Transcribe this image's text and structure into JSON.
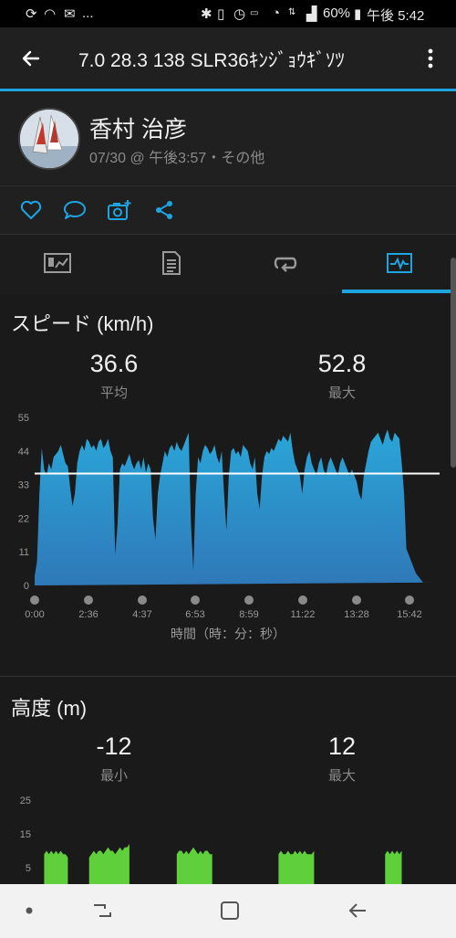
{
  "status_bar": {
    "battery": "60%",
    "time": "午後 5:42",
    "notif_more": "..."
  },
  "app_bar": {
    "title": "7.0  28.3  138  SLR36ｷﾝｼﾞｮｳｷﾞｿﾂ"
  },
  "profile": {
    "name": "香村 治彦",
    "meta": "07/30 @ 午後3:57・その他"
  },
  "tabs": [
    {
      "name": "summary",
      "active": false
    },
    {
      "name": "details",
      "active": false
    },
    {
      "name": "laps",
      "active": false
    },
    {
      "name": "charts",
      "active": true
    }
  ],
  "speed_section": {
    "title": "スピード (km/h)",
    "avg_value": "36.6",
    "avg_label": "平均",
    "max_value": "52.8",
    "max_label": "最大",
    "x_axis_label": "時間（時：分：秒）"
  },
  "altitude_section": {
    "title": "高度 (m)",
    "min_value": "-12",
    "min_label": "最小",
    "max_value": "12",
    "max_label": "最大"
  },
  "colors": {
    "accent": "#1ea5e0",
    "speed_fill_top": "#2aa6d8",
    "speed_fill_bottom": "#2f78b8",
    "altitude_fill": "#5fcf3c",
    "avg_line": "#ffffff"
  },
  "chart_data": [
    {
      "type": "area",
      "title": "スピード (km/h)",
      "xlabel": "時間（時：分：秒）",
      "ylabel": "",
      "x_ticks": [
        "0:00",
        "2:36",
        "4:37",
        "6:53",
        "8:59",
        "11:22",
        "13:28",
        "15:42"
      ],
      "y_ticks": [
        "0",
        "11",
        "22",
        "33",
        "44",
        "55"
      ],
      "ylim": [
        0,
        55
      ],
      "average_line": 36.6,
      "x": [
        0,
        0.1,
        0.2,
        0.3,
        0.4,
        0.5,
        0.6,
        0.7,
        0.8,
        0.9,
        1.0,
        1.1,
        1.2,
        1.3,
        1.4,
        1.5,
        1.6,
        1.7,
        1.8,
        1.9,
        2.0,
        2.1,
        2.2,
        2.3,
        2.4,
        2.5,
        2.6,
        2.7,
        2.8,
        2.9,
        3.0,
        3.1,
        3.2,
        3.3,
        3.4,
        3.5,
        3.6,
        3.7,
        3.8,
        3.9,
        4.0,
        4.1,
        4.2,
        4.3,
        4.4,
        4.5,
        4.6,
        4.7,
        4.8,
        4.9,
        5.0,
        5.1,
        5.2,
        5.3,
        5.4,
        5.5,
        5.6,
        5.7,
        5.8,
        5.9,
        6.0,
        6.1,
        6.2,
        6.3,
        6.4,
        6.5,
        6.6,
        6.7,
        6.8,
        6.9,
        7.0,
        7.1,
        7.2,
        7.3,
        7.4,
        7.5,
        7.6,
        7.7,
        7.8,
        7.9,
        8.0,
        8.1,
        8.2,
        8.3,
        8.4,
        8.5,
        8.6,
        8.7,
        8.8,
        8.9,
        9.0,
        9.1,
        9.2,
        9.3,
        9.4,
        9.5,
        9.6,
        9.7,
        9.8,
        9.9,
        10.0,
        10.1,
        10.2,
        10.3,
        10.4,
        10.5,
        10.6,
        10.7,
        10.8,
        10.9,
        11.0,
        11.1,
        11.2,
        11.3,
        11.4,
        11.5,
        11.6,
        11.7,
        11.8,
        11.9,
        12.0,
        12.1,
        12.2,
        12.3,
        12.4,
        12.5,
        12.6,
        12.7,
        12.8,
        12.9,
        13.0,
        13.1,
        13.2,
        13.3,
        13.4,
        13.5,
        13.6,
        13.7,
        13.8,
        13.9,
        14.0,
        14.1,
        14.2,
        14.3,
        14.4,
        14.5,
        14.6,
        14.7,
        14.8,
        14.9,
        15.0,
        15.1,
        15.2,
        15.3,
        15.4,
        15.5,
        15.6,
        15.7,
        15.8,
        15.9,
        16.0,
        16.1,
        16.2,
        16.3,
        16.4,
        16.5,
        16.6,
        16.7,
        16.8,
        16.9,
        17.0,
        17.1
      ],
      "series": [
        {
          "values": [
            3,
            8,
            30,
            45,
            38,
            36,
            40,
            38,
            42,
            43,
            44,
            46,
            43,
            40,
            39,
            32,
            26,
            30,
            40,
            44,
            46,
            44,
            48,
            47,
            45,
            46,
            44,
            47,
            48,
            45,
            46,
            48,
            44,
            42,
            10,
            20,
            38,
            40,
            39,
            41,
            43,
            40,
            38,
            40,
            41,
            38,
            42,
            37,
            40,
            38,
            22,
            15,
            30,
            36,
            40,
            44,
            42,
            45,
            46,
            44,
            47,
            45,
            44,
            46,
            48,
            50,
            20,
            5,
            30,
            42,
            40,
            44,
            46,
            45,
            43,
            44,
            46,
            42,
            40,
            44,
            30,
            18,
            36,
            44,
            45,
            43,
            44,
            42,
            46,
            45,
            44,
            40,
            38,
            42,
            30,
            25,
            36,
            42,
            44,
            43,
            45,
            44,
            46,
            48,
            47,
            49,
            48,
            47,
            50,
            44,
            40,
            38,
            36,
            30,
            38,
            42,
            44,
            40,
            38,
            36,
            40,
            42,
            38,
            36,
            40,
            42,
            40,
            38,
            36,
            40,
            42,
            40,
            38,
            36,
            38,
            36,
            34,
            30,
            28,
            36,
            40,
            44,
            47,
            48,
            49,
            50,
            48,
            46,
            49,
            51,
            48,
            47,
            50,
            49,
            48,
            40,
            30,
            12,
            10,
            8,
            6,
            4,
            3,
            2,
            1,
            1,
            1,
            1,
            1,
            1,
            1
          ]
        }
      ]
    },
    {
      "type": "area",
      "title": "高度 (m)",
      "y_ticks": [
        "5",
        "15",
        "25"
      ],
      "x": [
        0,
        0.1,
        0.2,
        0.3,
        0.4,
        0.5,
        0.6,
        0.7,
        0.8,
        0.9,
        1.0,
        1.1,
        1.2,
        1.3,
        1.4,
        1.5,
        1.6,
        1.7,
        1.8,
        1.9,
        2.0,
        2.1,
        2.2,
        2.3,
        2.4,
        2.5,
        2.6,
        2.7,
        2.8,
        2.9,
        3.0,
        3.1,
        3.2,
        3.3,
        3.4,
        3.5,
        3.6,
        3.7,
        3.8,
        3.9,
        4.0,
        4.1,
        4.2,
        4.3,
        4.4,
        4.5,
        4.6,
        4.7,
        4.8,
        4.9,
        5.0,
        5.1,
        5.2,
        5.3,
        5.4,
        5.5,
        5.6,
        5.7,
        5.8,
        5.9,
        6.0,
        6.1,
        6.2,
        6.3,
        6.4,
        6.5,
        6.6,
        6.7,
        6.8,
        6.9,
        7.0,
        7.1,
        7.2,
        7.3,
        7.4,
        7.5,
        7.6,
        7.7,
        7.8,
        7.9,
        8.0,
        8.1,
        8.2,
        8.3,
        8.4,
        8.5,
        8.6,
        8.7,
        8.8,
        8.9,
        9.0,
        9.1,
        9.2,
        9.3,
        9.4,
        9.5,
        9.6,
        9.7,
        9.8,
        9.9,
        10.0,
        10.1,
        10.2,
        10.3,
        10.4,
        10.5,
        10.6,
        10.7,
        10.8,
        10.9,
        11.0,
        11.1,
        11.2,
        11.3,
        11.4,
        11.5,
        11.6,
        11.7,
        11.8,
        11.9,
        12.0,
        12.1,
        12.2,
        12.3,
        12.4,
        12.5,
        12.6,
        12.7,
        12.8,
        12.9,
        13.0,
        13.1,
        13.2,
        13.3,
        13.4,
        13.5,
        13.6,
        13.7,
        13.8,
        13.9,
        14.0,
        14.1,
        14.2,
        14.3,
        14.4,
        14.5,
        14.6,
        14.7,
        14.8,
        14.9,
        15.0,
        15.1,
        15.2,
        15.3,
        15.4,
        15.5,
        15.6,
        15.7,
        15.8,
        15.9,
        16.0,
        16.1,
        16.2,
        16.3,
        16.4,
        16.5,
        16.6,
        16.7,
        16.8,
        16.9,
        17.0,
        17.1
      ],
      "series": [
        {
          "values": [
            -12,
            -12,
            -12,
            -12,
            9,
            10,
            9,
            10,
            9,
            10,
            9,
            10,
            9,
            9,
            8,
            -12,
            -12,
            -12,
            -12,
            -12,
            -12,
            -12,
            -12,
            8,
            9,
            10,
            9,
            10,
            10,
            9,
            10,
            11,
            10,
            10,
            9,
            10,
            11,
            10,
            11,
            11,
            12,
            -12,
            -12,
            -12,
            -12,
            -12,
            -12,
            -12,
            -12,
            -12,
            -12,
            -12,
            -12,
            -12,
            -12,
            -12,
            -12,
            -12,
            -12,
            -12,
            9,
            10,
            10,
            9,
            10,
            9,
            10,
            11,
            10,
            9,
            10,
            9,
            10,
            10,
            9,
            9,
            -12,
            -12,
            -12,
            -12,
            -12,
            -12,
            -12,
            -12,
            -12,
            -12,
            -12,
            -12,
            -12,
            -12,
            -12,
            -12,
            -12,
            -12,
            -12,
            -12,
            -12,
            -12,
            -12,
            -12,
            -12,
            -12,
            -12,
            9,
            10,
            9,
            9,
            10,
            9,
            9,
            10,
            9,
            10,
            9,
            10,
            9,
            9,
            9,
            10,
            -12,
            -12,
            -12,
            -12,
            -12,
            -12,
            -12,
            -12,
            -12,
            -12,
            -12,
            -12,
            -12,
            -12,
            -12,
            -12,
            -12,
            -12,
            -12,
            -12,
            -12,
            -12,
            -12,
            -12,
            -12,
            -12,
            -12,
            -12,
            -12,
            9,
            10,
            9,
            10,
            9,
            10,
            9,
            10,
            -12,
            -12,
            -12,
            -12,
            -12,
            -12,
            -12,
            -12,
            -12,
            -12,
            -12,
            -12,
            -12,
            -12,
            -12,
            -12,
            -12
          ]
        }
      ]
    }
  ]
}
